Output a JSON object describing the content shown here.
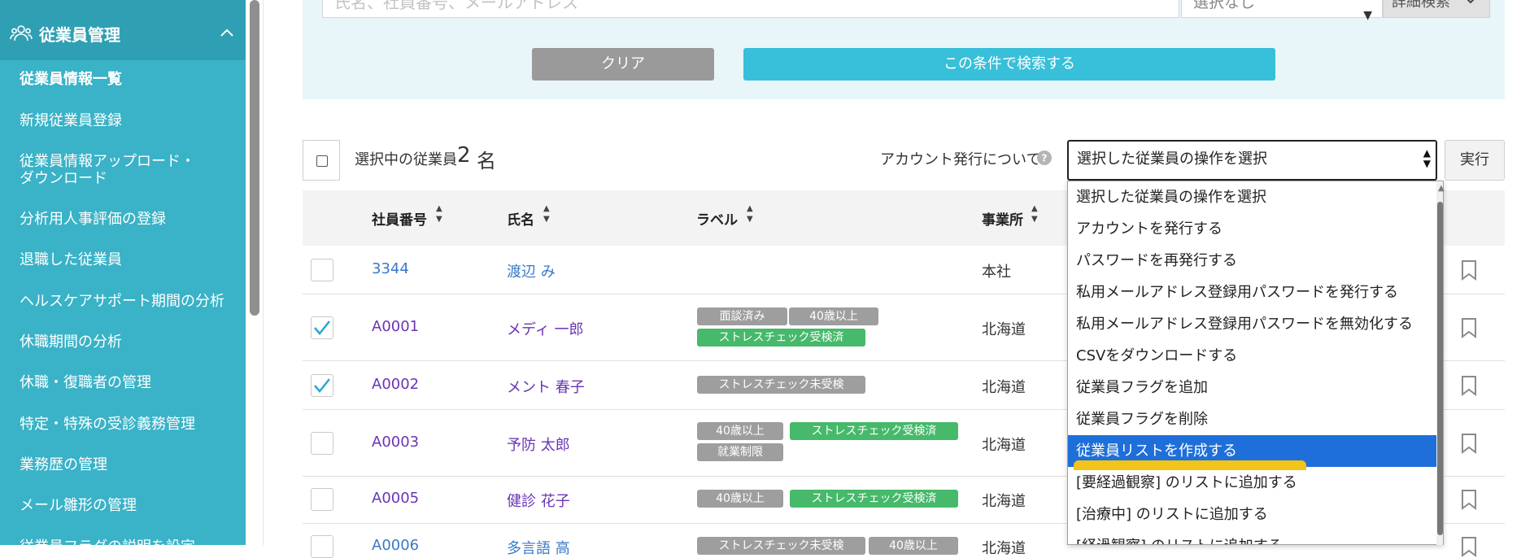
{
  "sidebar": {
    "section_title": "従業員管理",
    "items": [
      {
        "label": "従業員情報一覧",
        "active": true
      },
      {
        "label": "新規従業員登録"
      },
      {
        "label": "従業員情報アップロード・"
      },
      {
        "label": "ダウンロード"
      },
      {
        "label": "分析用人事評価の登録"
      },
      {
        "label": "退職した従業員"
      },
      {
        "label": "ヘルスケアサポート期間の分析"
      },
      {
        "label": "休職期間の分析"
      },
      {
        "label": "休職・復職者の管理"
      },
      {
        "label": "特定・特殊の受診義務管理"
      },
      {
        "label": "業務歴の管理"
      },
      {
        "label": "メール雛形の管理"
      },
      {
        "label": "従業員フラグの説明を設定"
      }
    ]
  },
  "search": {
    "keyword_placeholder": "氏名、社員番号、メールアドレス",
    "select_value": "選択なし",
    "advanced_label": "詳細検索",
    "clear_label": "クリア",
    "submit_label": "この条件で検索する"
  },
  "selection": {
    "label": "選択中の従業員",
    "count": "2",
    "unit": "名",
    "account_label": "アカウント発行について",
    "operation_select_value": "選択した従業員の操作を選択",
    "execute_label": "実行"
  },
  "table": {
    "headers": {
      "id": "社員番号",
      "name": "氏名",
      "label": "ラベル",
      "office": "事業所"
    },
    "rows": [
      {
        "id": "3344",
        "name": "渡辺 み",
        "office": "本社",
        "checked": false,
        "labels": []
      },
      {
        "id": "A0001",
        "name": "メディ 一郎",
        "office": "北海道",
        "checked": true,
        "labels": [
          "面談済み",
          "40歳以上",
          "ストレスチェック受検済"
        ]
      },
      {
        "id": "A0002",
        "name": "メント 春子",
        "office": "北海道",
        "checked": true,
        "labels": [
          "ストレスチェック未受検"
        ]
      },
      {
        "id": "A0003",
        "name": "予防 太郎",
        "office": "北海道",
        "checked": false,
        "labels": [
          "40歳以上",
          "ストレスチェック受検済",
          "就業制限"
        ]
      },
      {
        "id": "A0005",
        "name": "健診 花子",
        "office": "北海道",
        "checked": false,
        "labels": [
          "40歳以上",
          "ストレスチェック受検済"
        ]
      },
      {
        "id": "A0006",
        "name": "多言語 高",
        "office": "北海道",
        "checked": false,
        "labels": [
          "ストレスチェック未受検",
          "40歳以上"
        ]
      }
    ]
  },
  "dropdown": {
    "options": [
      "選択した従業員の操作を選択",
      "アカウントを発行する",
      "パスワードを再発行する",
      "私用メールアドレス登録用パスワードを発行する",
      "私用メールアドレス登録用パスワードを無効化する",
      "CSVをダウンロードする",
      "従業員フラグを追加",
      "従業員フラグを削除",
      "従業員リストを作成する",
      "[要経過観察] のリストに追加する",
      "[治療中] のリストに追加する",
      "[経過観察] のリストに追加する"
    ],
    "highlighted_index": 8
  },
  "colors": {
    "sidebar": "#3ab2c7",
    "accent": "#38bfd9",
    "highlight": "#1e6fd9",
    "tag_gray": "#9e9e9e",
    "tag_green": "#46b96b",
    "link": "#6a35b5"
  }
}
